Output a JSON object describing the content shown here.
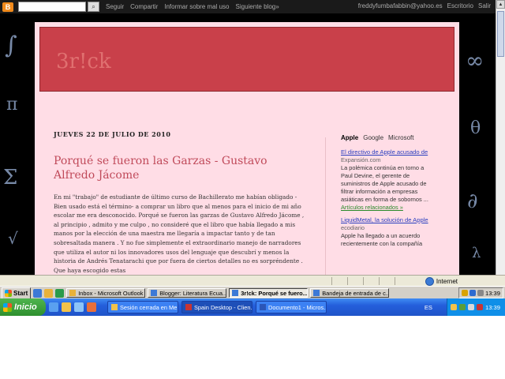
{
  "navbar": {
    "logo": "B",
    "links": [
      "Seguir",
      "Compartir",
      "Informar sobre mal uso",
      "Siguiente blog»"
    ],
    "user_email": "freddyfumbafabbin@yahoo.es",
    "right_links": [
      "Escritorio",
      "Salir"
    ]
  },
  "blog": {
    "title": "3r!ck",
    "post_date": "JUEVES 22 DE JULIO DE 2010",
    "post_title": "Porqué se fueron las Garzas - Gustavo Alfredo Jácome",
    "post_paragraph_1": "En mi \"trabajo\" de estudiante de último curso de Bachillerato me habían obligado - Bien usado está el término- a comprar un libro que al menos para el inicio de mi año escolar me era desconocido. Porqué se fueron las garzas de Gustavo Alfredo Jácome , al principio , admito y me culpo , no consideré que el libro que había llegado a mis manos por la elección de una maestra me llegaría a impactar tanto y de tan sobresaltada manera . Y no fue simplemente el extraordinario manejo de narradores que utiliza el autor ni los innovadores usos del lenguaje que descubrí y menos la historia de Andrés Tenatarachi que por fuera de ciertos detalles no es sorpréndente . Que haya escogido estas"
  },
  "sidebar": {
    "tabs": [
      {
        "label": "Apple",
        "active": true
      },
      {
        "label": "Google",
        "active": false
      },
      {
        "label": "Microsoft",
        "active": false
      }
    ],
    "news": [
      {
        "headline": "El directivo de Apple acusado de",
        "source": "Expansión.com",
        "snippet": "La polémica continúa en torno a Paul Devine, el gerente de suministros de Apple acusado de filtrar información a empresas asiáticas en forma de sobornos ...",
        "related": "Artículos relacionados »"
      },
      {
        "headline": "LiquidMetal, la solución de Apple",
        "source": "ecodiario",
        "snippet": "Apple ha llegado a un acuerdo recientemente con la compañía",
        "related": ""
      }
    ]
  },
  "statusbar": {
    "zone": "Internet"
  },
  "taskbar_classic": {
    "start": "Start",
    "buttons": [
      {
        "label": "Inbox - Microsoft Outlook",
        "active": false
      },
      {
        "label": "Blogger: Literatura Ecua...",
        "active": false
      },
      {
        "label": "3r!ck: Porqué se fuero...",
        "active": true
      },
      {
        "label": "Bandeja de entrada de c...",
        "active": false
      }
    ],
    "clock": "13:39"
  },
  "taskbar_xp": {
    "start": "Inicio",
    "buttons": [
      {
        "label": "Sesión cerrada en Me...",
        "active": false
      },
      {
        "label": "Spain Desktop - Clien...",
        "active": true
      },
      {
        "label": "Documento1 - Micros...",
        "active": false
      }
    ],
    "language": "ES",
    "clock": "13:39"
  },
  "colors": {
    "header": "#c9404a",
    "page": "#ffdde6",
    "post_title": "#c04a5a",
    "link": "#2a3fbf"
  }
}
